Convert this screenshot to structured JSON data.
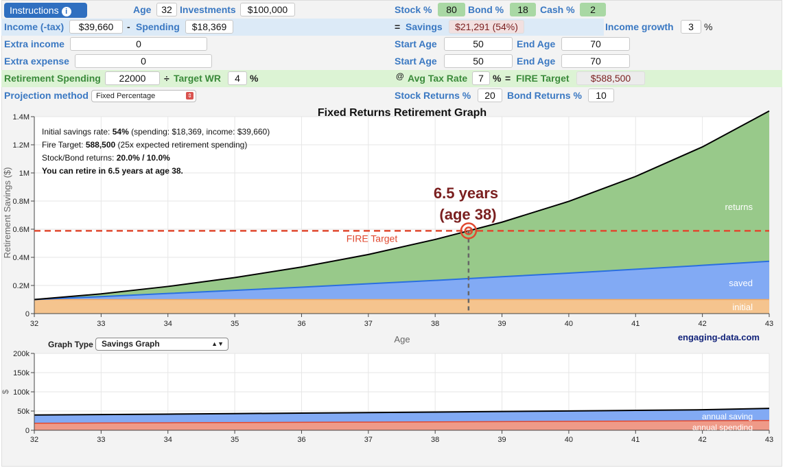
{
  "header": {
    "instructions_label": "Instructions",
    "instructions_icon": "info-icon",
    "age_label": "Age",
    "age_value": "32",
    "investments_label": "Investments",
    "investments_value": "$100,000",
    "stock_label": "Stock %",
    "stock_value": "80",
    "bond_label": "Bond %",
    "bond_value": "18",
    "cash_label": "Cash %",
    "cash_value": "2"
  },
  "income": {
    "income_label": "Income (-tax)",
    "income_value": "$39,660",
    "minus": "-",
    "spending_label": "Spending",
    "spending_value": "$18,369",
    "equals": "=",
    "savings_label": "Savings",
    "savings_value": "$21,291 (54%)",
    "growth_label": "Income growth",
    "growth_value": "3",
    "growth_unit": "%"
  },
  "extra_income": {
    "label": "Extra income",
    "value": "0",
    "start_label": "Start Age",
    "start_value": "50",
    "end_label": "End Age",
    "end_value": "70"
  },
  "extra_expense": {
    "label": "Extra expense",
    "value": "0",
    "start_label": "Start Age",
    "start_value": "50",
    "end_label": "End Age",
    "end_value": "70"
  },
  "retirement": {
    "spending_label": "Retirement Spending",
    "spending_value": "22000",
    "divide": "÷",
    "wr_label": "Target WR",
    "wr_value": "4",
    "wr_unit": "%",
    "at": "@",
    "tax_label": "Avg Tax Rate",
    "tax_value": "7",
    "tax_unit": "%",
    "equals": "=",
    "fire_label": "FIRE Target",
    "fire_value": "$588,500"
  },
  "projection": {
    "method_label": "Projection method",
    "method_value": "Fixed Percentage",
    "stock_ret_label": "Stock Returns %",
    "stock_ret_value": "20",
    "bond_ret_label": "Bond Returns %",
    "bond_ret_value": "10"
  },
  "colors": {
    "initial": "#f5c48e",
    "saved": "#82aaf4",
    "returns": "#98c98a",
    "fire_line": "#e0482f",
    "annotation": "#7a1f1f",
    "spending": "#ef9a88"
  },
  "main_chart": {
    "title": "Fixed Returns Retirement Graph",
    "ylabel": "Retirement Savings ($)",
    "xlabel": "Age",
    "yticks": [
      "0",
      "0.2M",
      "0.4M",
      "0.6M",
      "0.8M",
      "1M",
      "1.2M",
      "1.4M"
    ],
    "xticks": [
      "32",
      "33",
      "34",
      "35",
      "36",
      "37",
      "38",
      "39",
      "40",
      "41",
      "42",
      "43"
    ],
    "info": [
      {
        "pre": "Initial savings rate: ",
        "bold": "54%",
        "post": " (spending: $18,369, income: $39,660)"
      },
      {
        "pre": "Fire Target: ",
        "bold": "588,500",
        "post": " (25x expected retirement spending)"
      },
      {
        "pre": "Stock/Bond returns: ",
        "bold": "20.0% / 10.0%",
        "post": ""
      },
      {
        "pre": "",
        "bold": "You can retire in 6.5 years at age 38.",
        "post": ""
      }
    ],
    "annotation_line1": "6.5 years",
    "annotation_line2": "(age 38)",
    "fire_label": "FIRE Target",
    "label_returns": "returns",
    "label_saved": "saved",
    "label_initial": "initial",
    "brand": "engaging-data.com"
  },
  "graph_type": {
    "label": "Graph Type",
    "value": "Savings Graph"
  },
  "second_chart": {
    "ylabel": "$",
    "yticks": [
      "0",
      "50k",
      "100k",
      "150k",
      "200k"
    ],
    "xticks": [
      "32",
      "33",
      "34",
      "35",
      "36",
      "37",
      "38",
      "39",
      "40",
      "41",
      "42",
      "43"
    ],
    "label_saving": "annual saving",
    "label_spending": "annual spending"
  },
  "chart_data": [
    {
      "type": "area",
      "title": "Fixed Returns Retirement Graph",
      "xlabel": "Age",
      "ylabel": "Retirement Savings ($)",
      "x": [
        32,
        33,
        34,
        35,
        36,
        37,
        38,
        39,
        40,
        41,
        42,
        43
      ],
      "xlim": [
        32,
        43
      ],
      "ylim": [
        0,
        1400000
      ],
      "series": [
        {
          "name": "initial",
          "values": [
            100000,
            100000,
            100000,
            100000,
            100000,
            100000,
            100000,
            100000,
            100000,
            100000,
            100000,
            100000
          ]
        },
        {
          "name": "saved",
          "values": [
            100000,
            121000,
            143000,
            165000,
            188000,
            212000,
            236000,
            262000,
            288000,
            315000,
            343000,
            372000
          ]
        },
        {
          "name": "returns",
          "values": [
            100000,
            140000,
            193000,
            256000,
            331000,
            420000,
            527000,
            650000,
            798000,
            975000,
            1185000,
            1440000
          ]
        }
      ],
      "fire_target": 588500,
      "retire_age": 38.5,
      "grid": true
    },
    {
      "type": "area",
      "ylabel": "$",
      "x": [
        32,
        33,
        34,
        35,
        36,
        37,
        38,
        39,
        40,
        41,
        42,
        43
      ],
      "xlim": [
        32,
        43
      ],
      "ylim": [
        0,
        200000
      ],
      "series": [
        {
          "name": "annual spending",
          "values": [
            18369,
            18920,
            19488,
            20072,
            20675,
            21295,
            21934,
            22592,
            23270,
            23968,
            24687,
            25427
          ]
        },
        {
          "name": "annual saving",
          "values": [
            39660,
            40850,
            42075,
            43337,
            44637,
            45977,
            47356,
            48776,
            50240,
            51747,
            53299,
            57000
          ]
        }
      ],
      "grid": true
    }
  ]
}
